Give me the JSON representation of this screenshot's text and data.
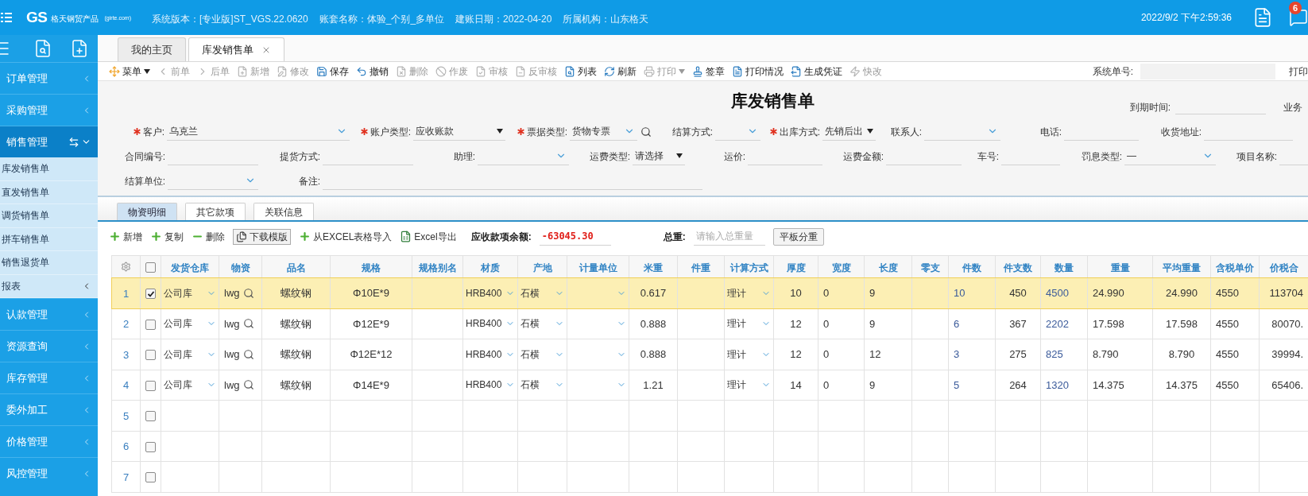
{
  "header": {
    "logo": "GS",
    "logo_tagline": "格天钢贸产品",
    "logo_domain": "(girte.com)",
    "info": [
      "系统版本：[专业版]ST_VGS.22.0620",
      "账套名称：体验_个别_多单位",
      "建账日期：2022-04-20",
      "所属机构：山东格天"
    ],
    "datetime": "2022/9/2 下午2:59:36",
    "message_badge": "6"
  },
  "sidebar": {
    "items": [
      {
        "label": "订单管理",
        "selected": false,
        "expanded": false
      },
      {
        "label": "采购管理",
        "selected": false,
        "expanded": false
      },
      {
        "label": "销售管理",
        "selected": true,
        "expanded": true,
        "children": [
          {
            "label": "库发销售单",
            "kind": "page"
          },
          {
            "label": "直发销售单",
            "kind": "page"
          },
          {
            "label": "调货销售单",
            "kind": "page"
          },
          {
            "label": "拼车销售单",
            "kind": "page"
          },
          {
            "label": "销售退货单",
            "kind": "page"
          },
          {
            "label": "报表",
            "kind": "group"
          }
        ]
      },
      {
        "label": "认款管理",
        "selected": false,
        "expanded": false
      },
      {
        "label": "资源查询",
        "selected": false,
        "expanded": false
      },
      {
        "label": "库存管理",
        "selected": false,
        "expanded": false
      },
      {
        "label": "委外加工",
        "selected": false,
        "expanded": false
      },
      {
        "label": "价格管理",
        "selected": false,
        "expanded": false
      },
      {
        "label": "风控管理",
        "selected": false,
        "expanded": false
      }
    ]
  },
  "tabs": [
    {
      "label": "我的主页",
      "selected": false,
      "closable": false
    },
    {
      "label": "库发销售单",
      "selected": true,
      "closable": true
    }
  ],
  "toolbar": {
    "items": [
      {
        "label": "菜单",
        "disabled": false,
        "dropdown": true
      },
      {
        "label": "前单",
        "disabled": true,
        "dropdown": false
      },
      {
        "label": "后单",
        "disabled": true,
        "dropdown": false
      },
      {
        "label": "新增",
        "disabled": true,
        "dropdown": false
      },
      {
        "label": "修改",
        "disabled": true,
        "dropdown": false
      },
      {
        "label": "保存",
        "disabled": false,
        "dropdown": false
      },
      {
        "label": "撤销",
        "disabled": false,
        "dropdown": false
      },
      {
        "label": "删除",
        "disabled": true,
        "dropdown": false
      },
      {
        "label": "作废",
        "disabled": true,
        "dropdown": false
      },
      {
        "label": "审核",
        "disabled": true,
        "dropdown": false
      },
      {
        "label": "反审核",
        "disabled": true,
        "dropdown": false
      },
      {
        "label": "列表",
        "disabled": false,
        "dropdown": false
      },
      {
        "label": "刷新",
        "disabled": false,
        "dropdown": false
      },
      {
        "label": "打印",
        "disabled": true,
        "dropdown": true
      },
      {
        "label": "签章",
        "disabled": false,
        "dropdown": false
      },
      {
        "label": "打印情况",
        "disabled": false,
        "dropdown": false
      },
      {
        "label": "生成凭证",
        "disabled": false,
        "dropdown": false
      },
      {
        "label": "快改",
        "disabled": true,
        "dropdown": false
      }
    ],
    "system_no_label": "系统单号:",
    "print_label": "打印"
  },
  "form": {
    "title": "库发销售单",
    "due_label": "到期时间:",
    "business_label": "业务",
    "rows": [
      [
        {
          "label": "客户:",
          "required": true,
          "value": "乌克兰",
          "kind": "combo"
        },
        {
          "label": "账户类型:",
          "required": true,
          "value": "应收账款",
          "kind": "select"
        },
        {
          "label": "票据类型:",
          "required": true,
          "value": "货物专票",
          "kind": "combo_search"
        },
        {
          "label": "结算方式:",
          "required": false,
          "kind": "combo"
        },
        {
          "label": "出库方式:",
          "required": true,
          "value": "先销后出",
          "kind": "select"
        },
        {
          "label": "联系人:",
          "required": false,
          "kind": "combo"
        },
        {
          "label": "电话:",
          "required": false,
          "kind": "text"
        },
        {
          "label": "收货地址:",
          "required": false,
          "kind": "text"
        }
      ],
      [
        {
          "label": "合同编号:",
          "required": false,
          "kind": "text"
        },
        {
          "label": "提货方式:",
          "required": false,
          "kind": "text"
        },
        {
          "label": "助理:",
          "required": false,
          "kind": "combo"
        },
        {
          "label": "运费类型:",
          "required": false,
          "value": "请选择",
          "kind": "select"
        },
        {
          "label": "运价:",
          "required": false,
          "kind": "text"
        },
        {
          "label": "运费金额:",
          "required": false,
          "kind": "text"
        },
        {
          "label": "车号:",
          "required": false,
          "kind": "text"
        },
        {
          "label": "罚息类型:",
          "required": false,
          "value": "—",
          "kind": "combo"
        },
        {
          "label": "项目名称:",
          "required": false,
          "kind": "text"
        }
      ],
      [
        {
          "label": "结算单位:",
          "required": false,
          "kind": "combo"
        },
        {
          "label": "备注:",
          "required": false,
          "kind": "text"
        }
      ]
    ]
  },
  "detail_tabs": [
    {
      "label": "物资明细",
      "selected": true
    },
    {
      "label": "其它款项",
      "selected": false
    },
    {
      "label": "关联信息",
      "selected": false
    }
  ],
  "grid_toolbar": {
    "buttons": [
      {
        "label": "新增",
        "kind": "add"
      },
      {
        "label": "复制",
        "kind": "add"
      },
      {
        "label": "删除",
        "kind": "delete"
      },
      {
        "label": "下载模版",
        "kind": "template"
      },
      {
        "label": "从EXCEL表格导入",
        "kind": "add"
      },
      {
        "label": "Excel导出",
        "kind": "export"
      }
    ],
    "balance_label": "应收款项余额:",
    "balance_value": "-63045.30",
    "total_weight_label": "总重:",
    "total_weight_placeholder": "请输入总重量",
    "split_button": "平板分重"
  },
  "table": {
    "select_all_checked": false,
    "columns": [
      {
        "label": "发货仓库",
        "kind": "select"
      },
      {
        "label": "物资",
        "kind": "lookup"
      },
      {
        "label": "品名",
        "kind": "text"
      },
      {
        "label": "规格",
        "kind": "text"
      },
      {
        "label": "规格别名",
        "kind": "text"
      },
      {
        "label": "材质",
        "kind": "select"
      },
      {
        "label": "产地",
        "kind": "select"
      },
      {
        "label": "计量单位",
        "kind": "select"
      },
      {
        "label": "米重",
        "kind": "text"
      },
      {
        "label": "件重",
        "kind": "text"
      },
      {
        "label": "计算方式",
        "kind": "select"
      },
      {
        "label": "厚度",
        "kind": "text"
      },
      {
        "label": "宽度",
        "kind": "text"
      },
      {
        "label": "长度",
        "kind": "text"
      },
      {
        "label": "零支",
        "kind": "text"
      },
      {
        "label": "件数",
        "kind": "text"
      },
      {
        "label": "件支数",
        "kind": "text"
      },
      {
        "label": "数量",
        "kind": "text"
      },
      {
        "label": "重量",
        "kind": "text"
      },
      {
        "label": "平均重量",
        "kind": "text"
      },
      {
        "label": "含税单价",
        "kind": "text"
      },
      {
        "label": "价税合",
        "kind": "text"
      }
    ],
    "rows": [
      {
        "number": "1",
        "checked": true,
        "selected": true,
        "cells": [
          "公司库",
          "lwg",
          "螺纹钢",
          "Φ10E*9",
          null,
          "HRB400",
          "石横",
          null,
          "0.617",
          null,
          "理计",
          "10",
          "0",
          "9",
          null,
          "10",
          "450",
          "4500",
          "24.990",
          "24.990",
          "4550",
          "113704"
        ]
      },
      {
        "number": "2",
        "checked": false,
        "selected": false,
        "cells": [
          "公司库",
          "lwg",
          "螺纹钢",
          "Φ12E*9",
          null,
          "HRB400",
          "石横",
          null,
          "0.888",
          null,
          "理计",
          "12",
          "0",
          "9",
          null,
          "6",
          "367",
          "2202",
          "17.598",
          "17.598",
          "4550",
          "80070."
        ]
      },
      {
        "number": "3",
        "checked": false,
        "selected": false,
        "cells": [
          "公司库",
          "lwg",
          "螺纹钢",
          "Φ12E*12",
          null,
          "HRB400",
          "石横",
          null,
          "0.888",
          null,
          "理计",
          "12",
          "0",
          "12",
          null,
          "3",
          "275",
          "825",
          "8.790",
          "8.790",
          "4550",
          "39994."
        ]
      },
      {
        "number": "4",
        "checked": false,
        "selected": false,
        "cells": [
          "公司库",
          "lwg",
          "螺纹钢",
          "Φ14E*9",
          null,
          "HRB400",
          "石横",
          null,
          "1.21",
          null,
          "理计",
          "14",
          "0",
          "9",
          null,
          "5",
          "264",
          "1320",
          "14.375",
          "14.375",
          "4550",
          "65406."
        ]
      },
      {
        "number": "5",
        "checked": false,
        "selected": false
      },
      {
        "number": "6",
        "checked": false,
        "selected": false
      },
      {
        "number": "7",
        "checked": false,
        "selected": false
      }
    ]
  }
}
